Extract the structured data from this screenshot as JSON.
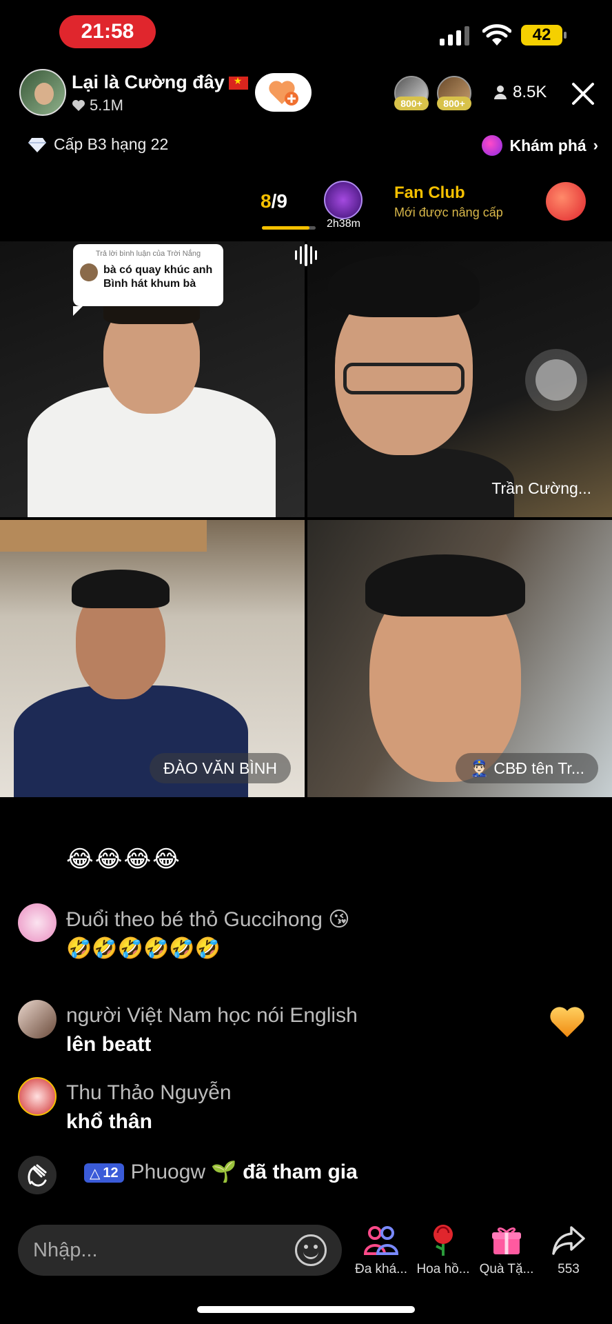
{
  "status_bar": {
    "time": "21:58",
    "battery": "42"
  },
  "host": {
    "name": "Lại là Cường đây",
    "likes": "5.1M",
    "level": "Cấp B3 hạng 22"
  },
  "top_viewers": [
    {
      "badge": "800+"
    },
    {
      "badge": "800+"
    }
  ],
  "viewer_count": "8.5K",
  "explore_label": "Khám phá",
  "fan_club": {
    "progress_current": "8",
    "progress_total": "/9",
    "progress_fraction": 0.89,
    "timer": "2h38m",
    "title": "Fan Club",
    "subtitle": "Mới được nâng cấp"
  },
  "reply_card": {
    "header": "Trả lời bình luận của Trời Nắng",
    "text": "bà có quay khúc anh Bình hát khum bà"
  },
  "guests": [
    {
      "label": ""
    },
    {
      "label": "Trần Cường..."
    },
    {
      "label": "ĐÀO VĂN BÌNH"
    },
    {
      "label": "👮🏻‍♂️ CBĐ tên Tr..."
    }
  ],
  "chat": {
    "emoji_row": "😂😂😂😂",
    "messages": [
      {
        "name": "Đuổi theo bé thỏ Guccihong 😘",
        "text": "🤣🤣🤣🤣🤣🤣"
      },
      {
        "name": "người Việt Nam học nói English",
        "text": "lên beatt"
      },
      {
        "name": "Thu Thảo Nguyễn",
        "text": "khổ thân"
      }
    ],
    "join": {
      "badge": "12",
      "user": "Phuogw 🌱",
      "action": "đã tham gia"
    }
  },
  "input": {
    "placeholder": "Nhập..."
  },
  "actions": [
    {
      "label": "Đa khá...",
      "icon": "multi-guest-icon"
    },
    {
      "label": "Hoa hồ...",
      "icon": "rose-icon"
    },
    {
      "label": "Quà Tặ...",
      "icon": "gift-icon"
    },
    {
      "label": "553",
      "icon": "share-icon"
    }
  ],
  "colors": {
    "accent_yellow": "#f5c000",
    "record_red": "#e0262d",
    "gift_pink": "#ff4a8a"
  }
}
